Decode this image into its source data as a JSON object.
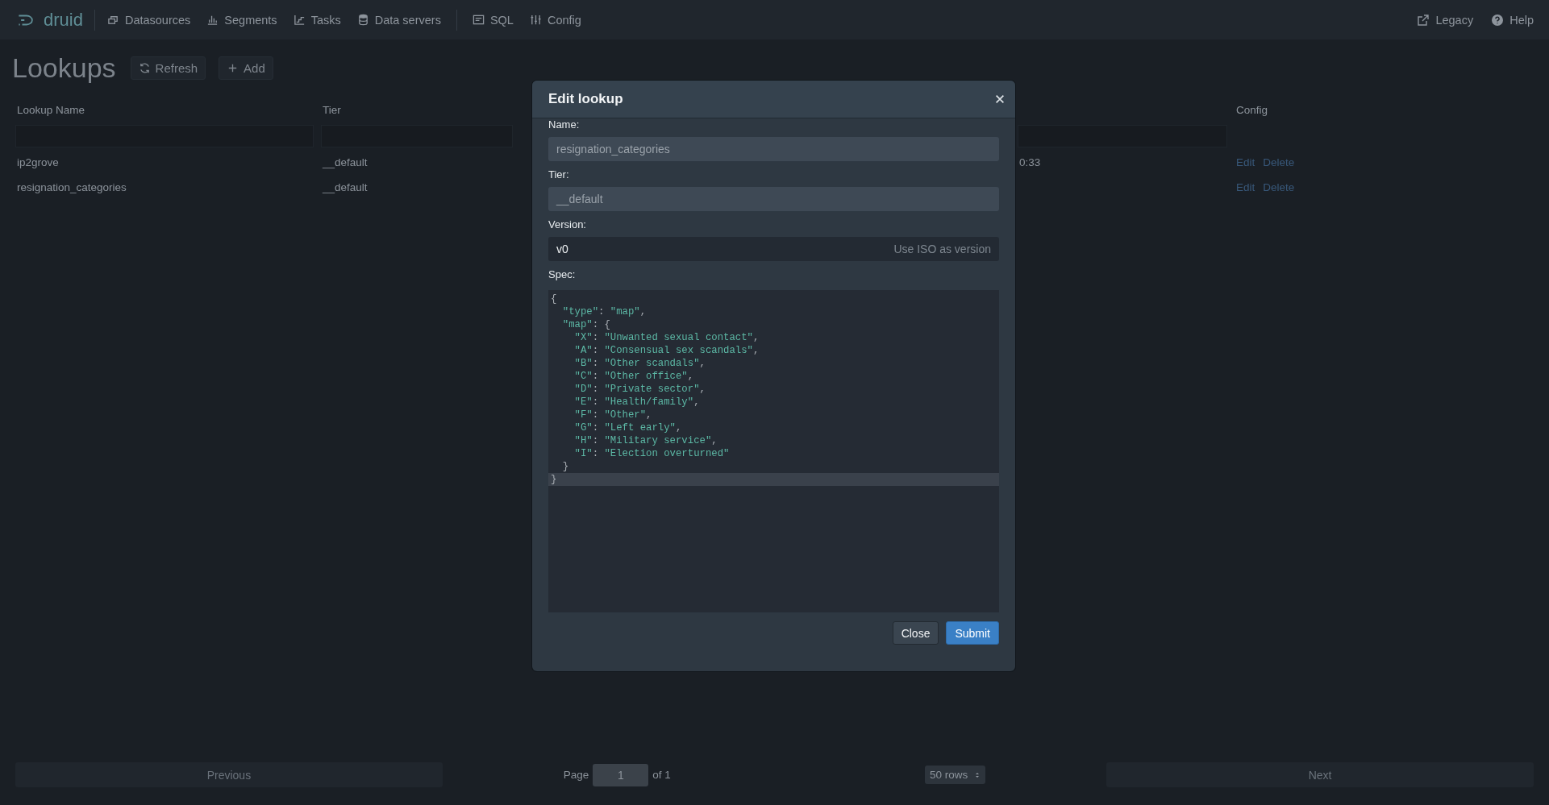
{
  "nav": {
    "logo": "druid",
    "groups": [
      [
        "Datasources",
        "Segments",
        "Tasks",
        "Data servers"
      ],
      [
        "SQL",
        "Config"
      ]
    ],
    "right_items": [
      "Legacy",
      "Help"
    ]
  },
  "page": {
    "title": "Lookups",
    "buttons": [
      "Refresh",
      "Add"
    ]
  },
  "table": {
    "columns": {
      "lookup_name": "Lookup Name",
      "tier": "Tier",
      "config": "Config"
    },
    "rows": [
      {
        "lookup_name": "ip2grove",
        "tier": "__default",
        "column_3": "0:33",
        "actions": [
          "Edit",
          "Delete"
        ]
      },
      {
        "lookup_name": "resignation_categories",
        "tier": "__default",
        "actions": [
          "Edit",
          "Delete"
        ]
      }
    ]
  },
  "dialog": {
    "title": "Edit lookup",
    "fields": [
      {
        "kind": "text",
        "label": "Name:",
        "value": "resignation_categories",
        "disabled": true
      },
      {
        "kind": "text",
        "label": "Tier:",
        "value": "__default",
        "disabled": true
      },
      {
        "kind": "version",
        "label": "Version:",
        "value": "v0",
        "action": "Use ISO as version",
        "disabled": false
      },
      {
        "kind": "code",
        "label": "Spec:",
        "lines": [
          {
            "text": "{",
            "active": false
          },
          {
            "text": "  \"type\": \"map\",",
            "active": false
          },
          {
            "text": "  \"map\": {",
            "active": false
          },
          {
            "text": "    \"X\": \"Unwanted sexual contact\",",
            "active": false
          },
          {
            "text": "    \"A\": \"Consensual sex scandals\",",
            "active": false
          },
          {
            "text": "    \"B\": \"Other scandals\",",
            "active": false
          },
          {
            "text": "    \"C\": \"Other office\",",
            "active": false
          },
          {
            "text": "    \"D\": \"Private sector\",",
            "active": false
          },
          {
            "text": "    \"E\": \"Health/family\",",
            "active": false
          },
          {
            "text": "    \"F\": \"Other\",",
            "active": false
          },
          {
            "text": "    \"G\": \"Left early\",",
            "active": false
          },
          {
            "text": "    \"H\": \"Military service\",",
            "active": false
          },
          {
            "text": "    \"I\": \"Election overturned\"",
            "active": false
          },
          {
            "text": "  }",
            "active": false
          },
          {
            "text": "}",
            "active": true
          }
        ]
      }
    ],
    "buttons": [
      {
        "label": "Close",
        "kind": "default"
      },
      {
        "label": "Submit",
        "kind": "primary"
      }
    ]
  },
  "pager": {
    "previous": {
      "label": "Previous",
      "disabled": true
    },
    "page_label": "Page",
    "page": "1",
    "of": "of 1",
    "rows": "50 rows",
    "next": {
      "label": "Next",
      "disabled": true
    }
  }
}
